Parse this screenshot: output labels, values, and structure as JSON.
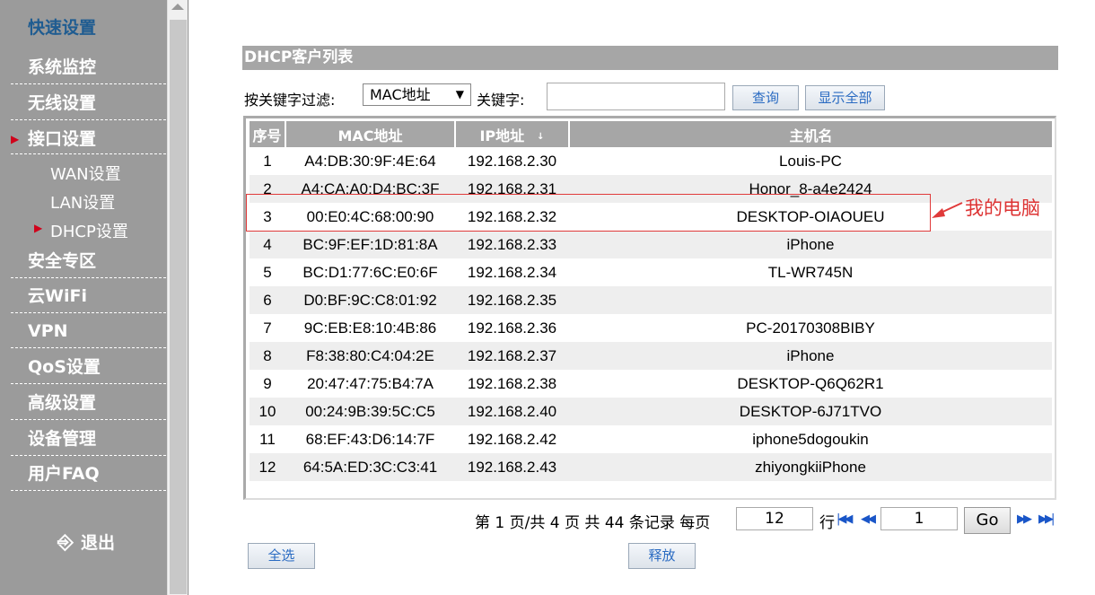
{
  "sidebar": {
    "items": [
      {
        "label": "快速设置"
      },
      {
        "label": "系统监控"
      },
      {
        "label": "无线设置"
      },
      {
        "label": "接口设置"
      },
      {
        "label": "安全专区"
      },
      {
        "label": "云WiFi"
      },
      {
        "label": "VPN"
      },
      {
        "label": "QoS设置"
      },
      {
        "label": "高级设置"
      },
      {
        "label": "设备管理"
      },
      {
        "label": "用户FAQ"
      }
    ],
    "subitems": [
      {
        "label": "WAN设置"
      },
      {
        "label": "LAN设置"
      },
      {
        "label": "DHCP设置"
      }
    ],
    "logout_label": "退出"
  },
  "page": {
    "title": "DHCP客户列表"
  },
  "filter": {
    "label": "按关键字过滤:",
    "selected": "MAC地址",
    "keyword_label": "关键字:",
    "keyword_value": "",
    "query_btn": "查询",
    "show_all_btn": "显示全部"
  },
  "table": {
    "headers": [
      "序号",
      "MAC地址",
      "IP地址",
      "主机名"
    ],
    "sort_icon": "↓",
    "rows": [
      {
        "no": "1",
        "mac": "A4:DB:30:9F:4E:64",
        "ip": "192.168.2.30",
        "host": "Louis-PC"
      },
      {
        "no": "2",
        "mac": "A4:CA:A0:D4:BC:3F",
        "ip": "192.168.2.31",
        "host": "Honor_8-a4e2424"
      },
      {
        "no": "3",
        "mac": "00:E0:4C:68:00:90",
        "ip": "192.168.2.32",
        "host": "DESKTOP-OIAOUEU"
      },
      {
        "no": "4",
        "mac": "BC:9F:EF:1D:81:8A",
        "ip": "192.168.2.33",
        "host": "iPhone"
      },
      {
        "no": "5",
        "mac": "BC:D1:77:6C:E0:6F",
        "ip": "192.168.2.34",
        "host": "TL-WR745N"
      },
      {
        "no": "6",
        "mac": "D0:BF:9C:C8:01:92",
        "ip": "192.168.2.35",
        "host": ""
      },
      {
        "no": "7",
        "mac": "9C:EB:E8:10:4B:86",
        "ip": "192.168.2.36",
        "host": "PC-20170308BIBY"
      },
      {
        "no": "8",
        "mac": "F8:38:80:C4:04:2E",
        "ip": "192.168.2.37",
        "host": "iPhone"
      },
      {
        "no": "9",
        "mac": "20:47:47:75:B4:7A",
        "ip": "192.168.2.38",
        "host": "DESKTOP-Q6Q62R1"
      },
      {
        "no": "10",
        "mac": "00:24:9B:39:5C:C5",
        "ip": "192.168.2.40",
        "host": "DESKTOP-6J71TVO"
      },
      {
        "no": "11",
        "mac": "68:EF:43:D6:14:7F",
        "ip": "192.168.2.42",
        "host": "iphone5dogoukin"
      },
      {
        "no": "12",
        "mac": "64:5A:ED:3C:C3:41",
        "ip": "192.168.2.43",
        "host": "zhiyongkiiPhone"
      }
    ]
  },
  "annotation": {
    "text": "我的电脑",
    "color": "#d33"
  },
  "pagination": {
    "page_prefix": "第",
    "current_page": "1",
    "page_sep": "页/共",
    "total_pages": "4",
    "pages_word": "页 共",
    "total_records": "44",
    "records_word": "条记录 每页",
    "per_page": "12",
    "rows_word": "行",
    "goto_value": "1",
    "go_label": "Go"
  },
  "actions": {
    "select_all": "全选",
    "release": "释放"
  }
}
